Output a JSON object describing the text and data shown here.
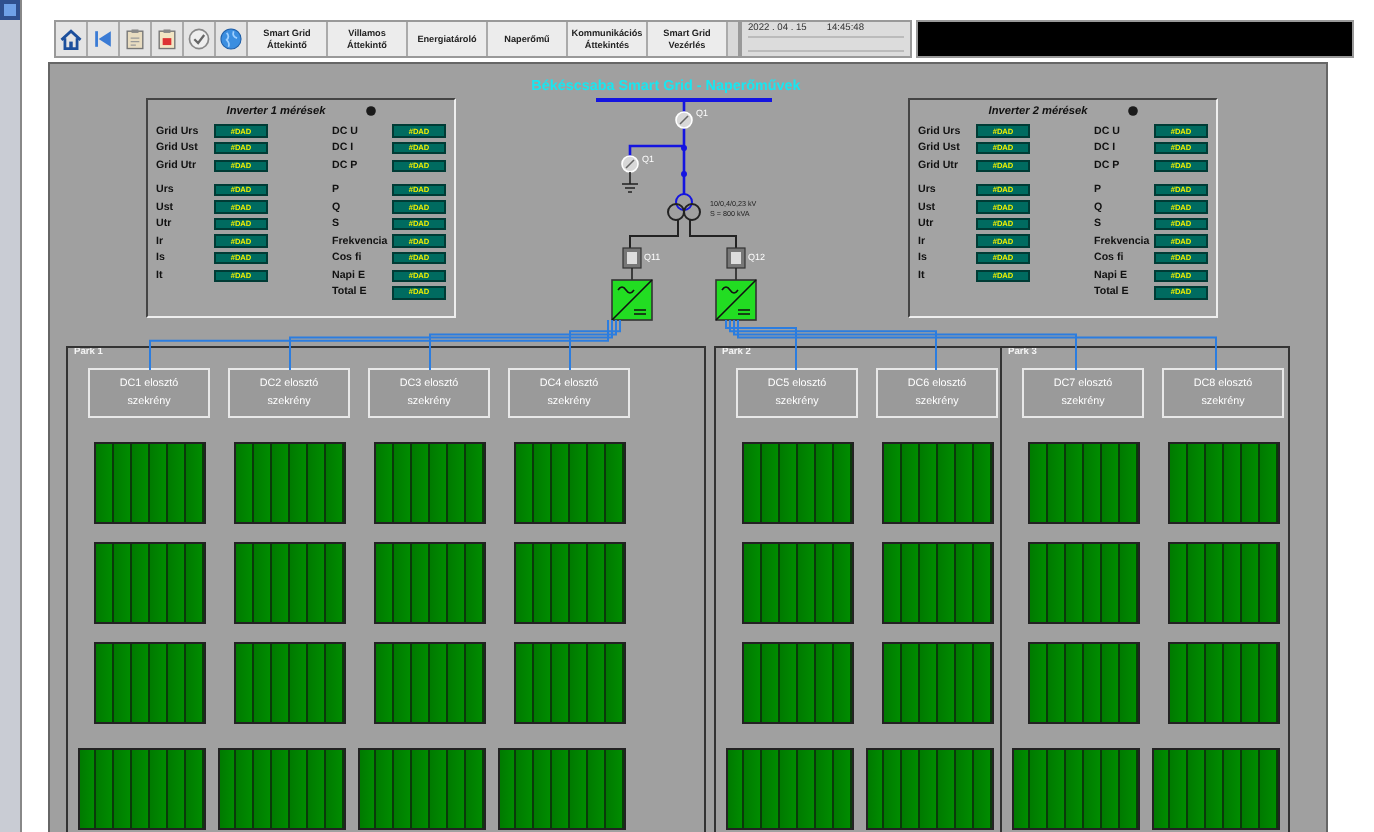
{
  "toolbar": {
    "icon_buttons": [
      {
        "kind": "home"
      },
      {
        "kind": "back"
      },
      {
        "kind": "clipboard"
      },
      {
        "kind": "report"
      },
      {
        "kind": "check"
      },
      {
        "kind": "globe"
      }
    ],
    "buttons": [
      "Smart Grid Áttekintő",
      "Villamos Áttekintő",
      "Energiatároló",
      "Naperőmű",
      "Kommunikációs Áttekintés",
      "Smart Grid Vezérlés"
    ],
    "date": "2022 . 04 . 15",
    "time": "14:45:48"
  },
  "diagram": {
    "title": "Békéscsaba Smart Grid - Naperőművek",
    "breakers": [
      "Q1",
      "Q1",
      "Q11",
      "Q12"
    ],
    "transformer_label": [
      "10/0,4/0,23 kV",
      "S = 800 kVA"
    ]
  },
  "inverters": [
    {
      "title": "Inverter 1 mérések",
      "left_groups": [
        [
          {
            "label": "Grid Urs",
            "value": "#DAD"
          },
          {
            "label": "Grid Ust",
            "value": "#DAD"
          },
          {
            "label": "Grid Utr",
            "value": "#DAD"
          }
        ],
        [
          {
            "label": "Urs",
            "value": "#DAD"
          },
          {
            "label": "Ust",
            "value": "#DAD"
          },
          {
            "label": "Utr",
            "value": "#DAD"
          },
          {
            "label": "Ir",
            "value": "#DAD"
          },
          {
            "label": "Is",
            "value": "#DAD"
          },
          {
            "label": "It",
            "value": "#DAD"
          }
        ]
      ],
      "right_groups": [
        [
          {
            "label": "DC U",
            "value": "#DAD"
          },
          {
            "label": "DC I",
            "value": "#DAD"
          },
          {
            "label": "DC P",
            "value": "#DAD"
          }
        ],
        [
          {
            "label": "P",
            "value": "#DAD"
          },
          {
            "label": "Q",
            "value": "#DAD"
          },
          {
            "label": "S",
            "value": "#DAD"
          },
          {
            "label": "Frekvencia",
            "value": "#DAD"
          },
          {
            "label": "Cos fi",
            "value": "#DAD"
          },
          {
            "label": "Napi E",
            "value": "#DAD"
          },
          {
            "label": "Total E",
            "value": "#DAD"
          }
        ]
      ]
    },
    {
      "title": "Inverter 2 mérések",
      "left_groups": [
        [
          {
            "label": "Grid Urs",
            "value": "#DAD"
          },
          {
            "label": "Grid Ust",
            "value": "#DAD"
          },
          {
            "label": "Grid Utr",
            "value": "#DAD"
          }
        ],
        [
          {
            "label": "Urs",
            "value": "#DAD"
          },
          {
            "label": "Ust",
            "value": "#DAD"
          },
          {
            "label": "Utr",
            "value": "#DAD"
          },
          {
            "label": "Ir",
            "value": "#DAD"
          },
          {
            "label": "Is",
            "value": "#DAD"
          },
          {
            "label": "It",
            "value": "#DAD"
          }
        ]
      ],
      "right_groups": [
        [
          {
            "label": "DC U",
            "value": "#DAD"
          },
          {
            "label": "DC I",
            "value": "#DAD"
          },
          {
            "label": "DC P",
            "value": "#DAD"
          }
        ],
        [
          {
            "label": "P",
            "value": "#DAD"
          },
          {
            "label": "Q",
            "value": "#DAD"
          },
          {
            "label": "S",
            "value": "#DAD"
          },
          {
            "label": "Frekvencia",
            "value": "#DAD"
          },
          {
            "label": "Cos fi",
            "value": "#DAD"
          },
          {
            "label": "Napi E",
            "value": "#DAD"
          },
          {
            "label": "Total E",
            "value": "#DAD"
          }
        ]
      ]
    }
  ],
  "parks": [
    {
      "name": "Park 1",
      "cabinets": [
        "DC1 elosztó szekrény",
        "DC2 elosztó szekrény",
        "DC3 elosztó szekrény",
        "DC4 elosztó szekrény"
      ]
    },
    {
      "name": "Park 2",
      "cabinets": [
        "DC5 elosztó szekrény",
        "DC6 elosztó szekrény"
      ]
    },
    {
      "name": "Park 3",
      "cabinets": [
        "DC7 elosztó szekrény",
        "DC8 elosztó szekrény"
      ]
    }
  ]
}
